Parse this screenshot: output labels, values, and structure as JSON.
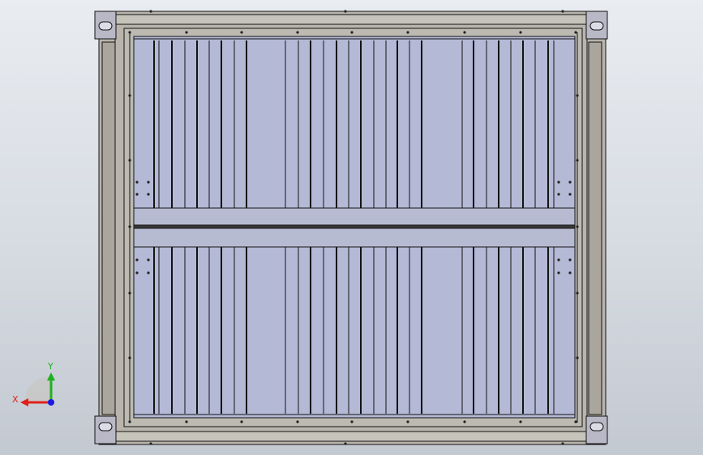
{
  "viewport": {
    "background_top": "#e9ecf0",
    "background_bottom": "#c3c9d1"
  },
  "model": {
    "description_type": "container-frame-top-view",
    "frame_color": "#b9b5ac",
    "panel_color": "#b4b9d6",
    "line_color": "#141414",
    "corner_castings": 4,
    "panel_sections": 2
  },
  "triad": {
    "x_label": "X",
    "y_label": "Y",
    "x_color": "#e0201a",
    "y_color": "#1fb01f",
    "z_color": "#1a1ae0"
  }
}
